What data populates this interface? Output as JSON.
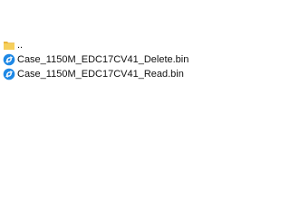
{
  "file_list": {
    "items": [
      {
        "name": "..",
        "icon": "folder-icon",
        "color": "#F0C14B"
      },
      {
        "name": "Case_1150M_EDC17CV41_Delete.bin",
        "icon": "bin-file-icon",
        "color": "#1E88E5"
      },
      {
        "name": "Case_1150M_EDC17CV41_Read.bin",
        "icon": "bin-file-icon",
        "color": "#1E88E5"
      }
    ]
  }
}
